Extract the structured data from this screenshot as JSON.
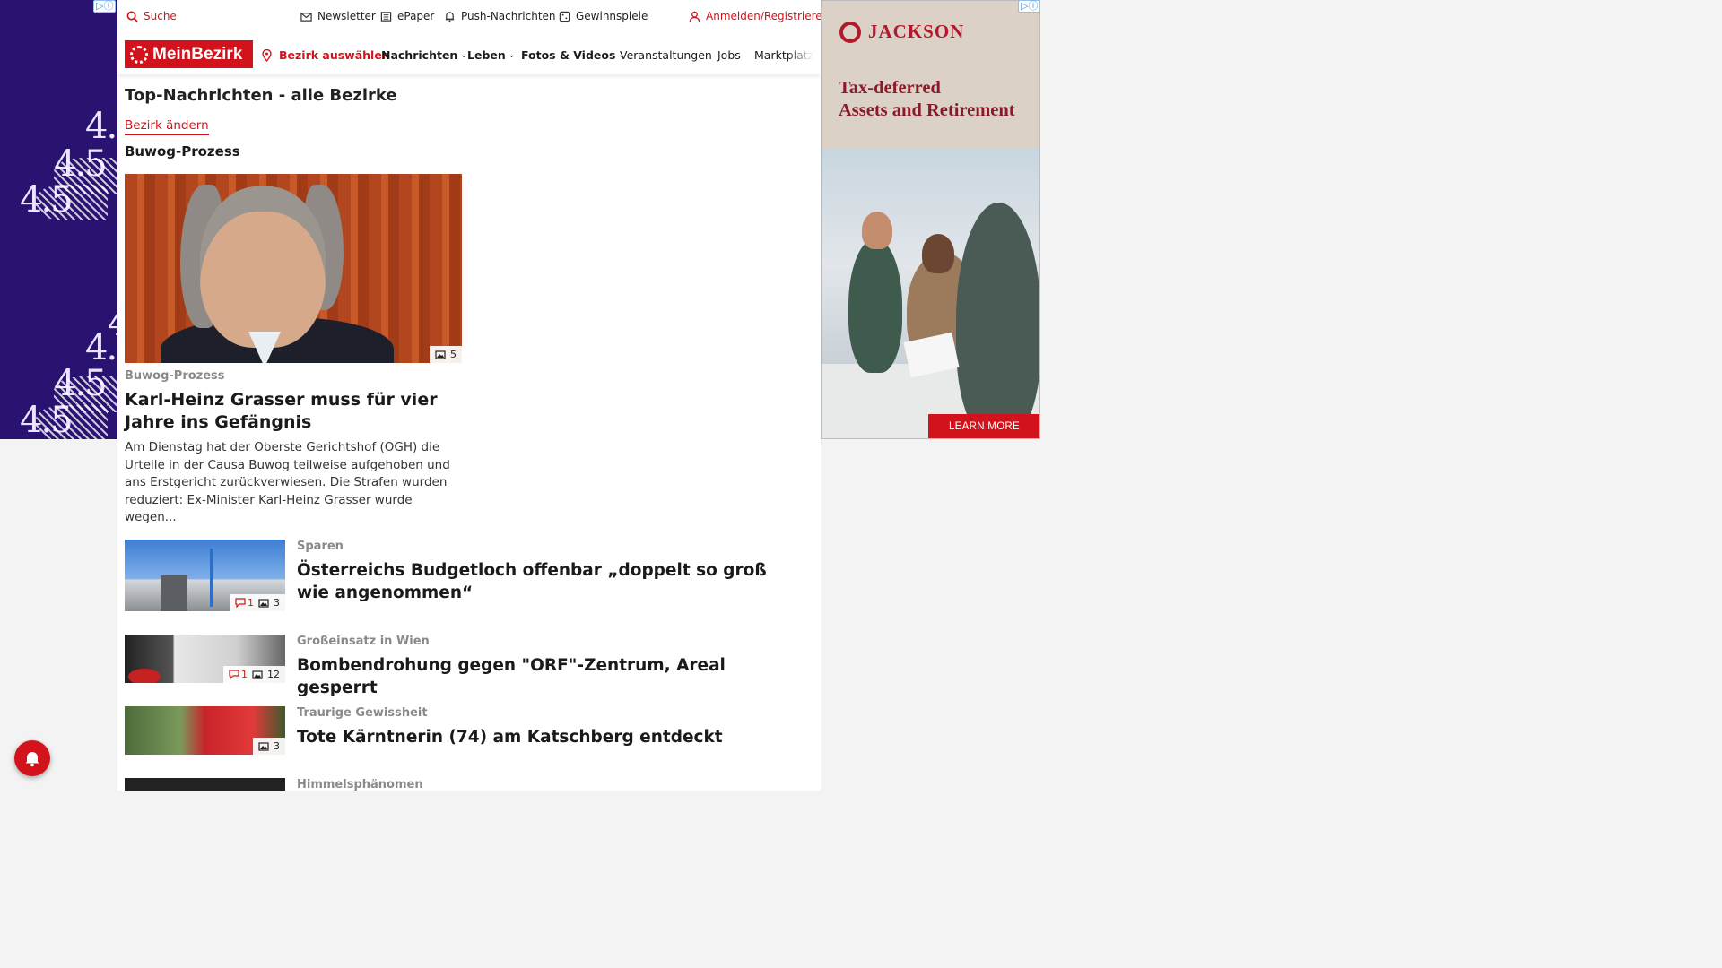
{
  "topbar": {
    "search": "Suche",
    "newsletter": "Newsletter",
    "epaper": "ePaper",
    "push": "Push-Nachrichten",
    "gewinnspiele": "Gewinnspiele",
    "login": "Anmelden/Registrieren"
  },
  "nav": {
    "logo": "MeinBezirk",
    "bezirk": "Bezirk auswählen",
    "items": [
      "Nachrichten",
      "Leben",
      "Fotos & Videos",
      "Veranstaltungen",
      "Jobs",
      "Marktplatz"
    ]
  },
  "page": {
    "title": "Top-Nachrichten - alle Bezirke",
    "change_link": "Bezirk ändern",
    "section": "Buwog-Prozess"
  },
  "hero": {
    "kicker": "Buwog-Prozess",
    "title": "Karl-Heinz Grasser muss für vier Jahre ins Gefängnis",
    "teaser": "Am Dienstag hat der Oberste Gerichtshof (OGH) die Urteile in der Causa Buwog teilweise aufgehoben und ans Erstgericht zurückverwiesen. Die Strafen wurden reduziert: Ex-Minister Karl-Heinz Grasser wurde wegen...",
    "images": "5"
  },
  "articles": [
    {
      "kicker": "Sparen",
      "title": "Österreichs Budgetloch offenbar „doppelt so groß wie angenommen“",
      "comments": "1",
      "images": "3"
    },
    {
      "kicker": "Großeinsatz in Wien",
      "title": "Bombendrohung gegen \"ORF\"-Zentrum, Areal gesperrt",
      "comments": "1",
      "images": "12"
    },
    {
      "kicker": "Traurige Gewissheit",
      "title": "Tote Kärntnerin (74) am Katschberg entdeckt",
      "images": "3"
    },
    {
      "kicker": "Himmelsphänomen"
    }
  ],
  "ad_right": {
    "brand": "JACKSON",
    "headline_1": "Tax-deferred",
    "headline_2": "Assets and Retirement",
    "cta": "LEARN MORE"
  },
  "ad_left": {
    "digits": "4.5"
  },
  "colors": {
    "brand_red": "#d3131b",
    "ad_left_bg": "#2a1270",
    "ad_right_bg": "#dcd1c6"
  }
}
